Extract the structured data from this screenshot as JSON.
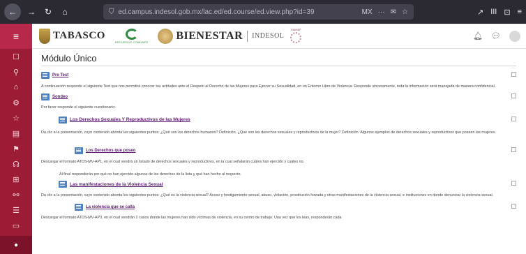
{
  "browser": {
    "url": "ed.campus.indesol.gob.mx/lac.ed/ed.course/ed.view.php?id=39",
    "actions": [
      "MX",
      "···",
      "✉",
      "☆"
    ],
    "tools": [
      "↗",
      "III",
      "⊡",
      "≡"
    ]
  },
  "header": {
    "brand_tabasco": "TABASCO",
    "logo_c_text": "RECURSOS COMUNES",
    "brand_bienestar": "BIENESTAR",
    "brand_indesol": "INDESOL",
    "indesol_mark_label": "PAIMEF"
  },
  "sidebar": {
    "menu_icon": "hamburger-icon",
    "items": [
      "☐",
      "⚲",
      "⌂",
      "⚙",
      "☆",
      "▤",
      "⚑",
      "☊",
      "⊞",
      "⚯",
      "☰",
      "▭",
      "◆"
    ],
    "bottom_icon": "●"
  },
  "main": {
    "course_title": "Módulo Único",
    "activities": [
      {
        "title": "Pre Test",
        "level": 0
      },
      {
        "desc": "A continuación responde el siguiente Test que nos permitirá conocer tus actitudes ante el Respeto al Derecho de las Mujeres para Ejercer su Sexualidad, en un Entorno Libre de Violencia. Responde sinceramente, toda la información será manejada de manera confidencial.",
        "level": 0
      },
      {
        "title": "Sondeo",
        "level": 0
      },
      {
        "desc": "Por favor responde el siguiente cuestionario:",
        "level": 0
      },
      {
        "title": "Los Derechos Sexuales Y Reproductivos de las Mujeres",
        "level": 1
      },
      {
        "desc": "Da clic a la presentación, cuyo contenido aborda las siguientes puntos: ¿Qué son los derechos humanos? Definición. ¿Qué son los derechos sexuales y reproductivos de la mujer? Definición. Algunos ejemplos de derechos sexuales y reproductivos que poseen las mujeres.",
        "level": 1
      },
      {
        "title": "Los Derechos que poseo",
        "level": 2
      },
      {
        "desc": "Descargar el formato ATDS-MV-AP1, en el cual vendrá un listado de derechos sexuales y reproductivos, en la cual señalarán cuáles han ejercido y cuáles no.",
        "level": 2
      },
      {
        "desc": "Al final responderán por qué no han ejercido algunos de los derechos de la lista y qué han hecho al respecto.",
        "level": 2
      },
      {
        "title": "Las manifestaciones de la Violencia Sexual",
        "level": 1
      },
      {
        "desc": "Da clic a la presentación, cuyo contenido aborda los siguientes puntos: ¿Qué es la violencia sexual? Acoso y hostigamiento sexual, abuso, violación, prostitución forzada y otras manifestaciones de la violencia sexual, e instituciones en donde denunciar la violencia sexual.",
        "level": 1
      },
      {
        "title": "La violencia que se calla",
        "level": 2
      },
      {
        "desc": "Descargar el formato ATDS-MV-AP3, en el cual vendrán 2 casos donde las mujeres han sido víctimas de violencia, en su centro de trabajo. Una vez que los leas, responderán cada",
        "level": 2
      }
    ]
  },
  "colors": {
    "sidebar": "#9d1c35",
    "sidebar_menu": "#b8284a",
    "link": "#5a1a6e",
    "activity_icon": "#4f82c3",
    "browser_bar": "#2b2a33"
  }
}
